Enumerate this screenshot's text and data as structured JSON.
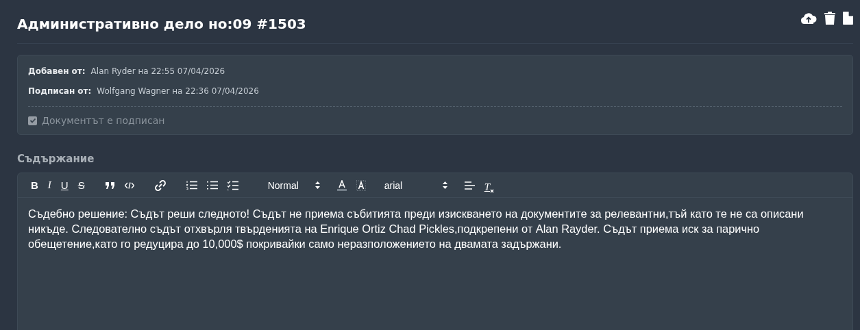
{
  "title": "Административно дело но:09 #1503",
  "actions": [
    {
      "kind": "upload"
    },
    {
      "kind": "delete"
    },
    {
      "kind": "file"
    }
  ],
  "info": {
    "rows": [
      {
        "label": "Добавен от:",
        "value": "Alan Ryder на 22:55 07/04/2026"
      },
      {
        "label": "Подписан от:",
        "value": "Wolfgang Wagner на 22:36 07/04/2026"
      }
    ],
    "checkbox": {
      "label": "Документът е подписан",
      "checked": true,
      "disabled": true
    }
  },
  "content_label": "Съдържание",
  "toolbar": [
    {
      "kind": "bold",
      "label": "B"
    },
    {
      "kind": "italic",
      "label": "I"
    },
    {
      "kind": "underline",
      "label": "U"
    },
    {
      "kind": "strike",
      "label": "S"
    },
    {
      "kind": "gap"
    },
    {
      "kind": "quote"
    },
    {
      "kind": "code"
    },
    {
      "kind": "gap"
    },
    {
      "kind": "link"
    },
    {
      "kind": "gap"
    },
    {
      "kind": "ordered"
    },
    {
      "kind": "bullet"
    },
    {
      "kind": "check"
    },
    {
      "kind": "gap"
    },
    {
      "kind": "select",
      "label": "Normal"
    },
    {
      "kind": "color"
    },
    {
      "kind": "background"
    },
    {
      "kind": "select",
      "label": "arial",
      "wide": true
    },
    {
      "kind": "align"
    },
    {
      "kind": "clean",
      "label": "T"
    }
  ],
  "body": "Съдебно решение: Съдът реши следното! Съдът не приема събитията преди изискването на документите за релевантни,тъй като те не са описани никъде. Следователно съдът отхвърля твърденията на Enrique Ortiz Chad Pickles,подкрепени от Alan Rayder. Съдът приема иск за парично обещетение,като го редуцира до 10,000$ покривайки само неразположението на двамата задържани."
}
